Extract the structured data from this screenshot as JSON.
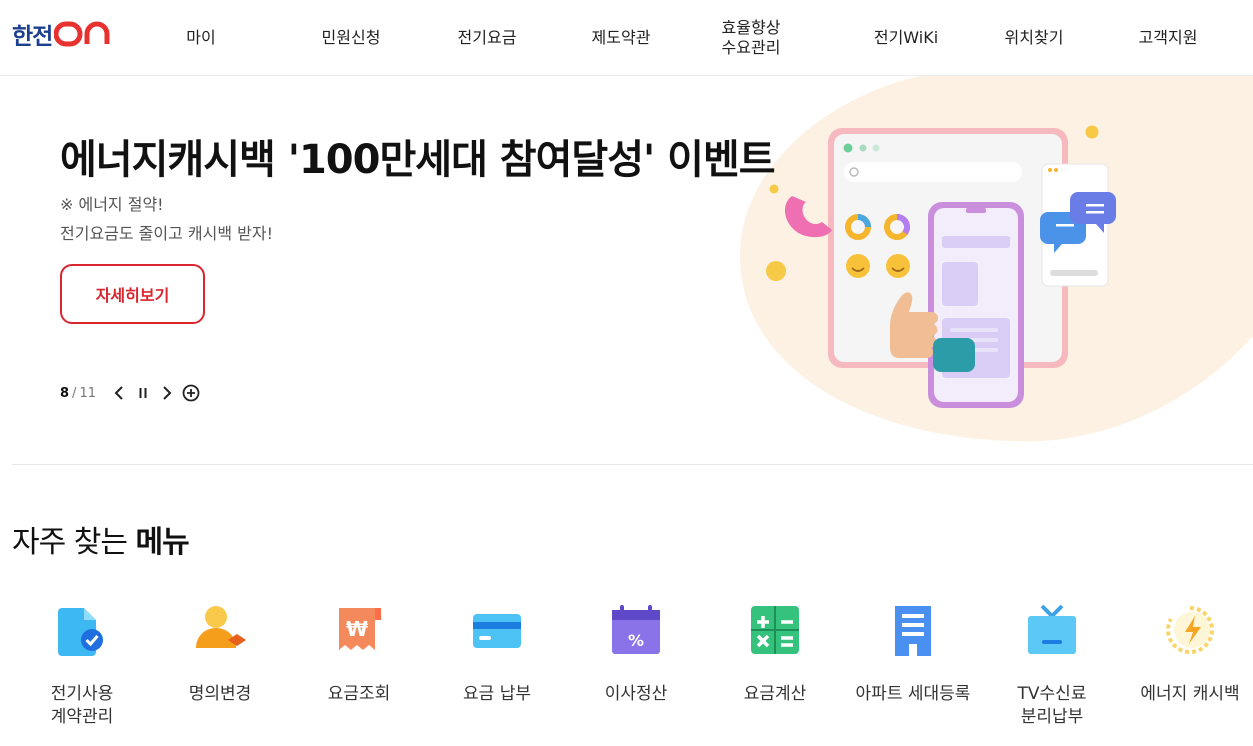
{
  "header": {
    "logo_text": "한전",
    "logo_suffix": "ON",
    "nav": [
      {
        "id": "my",
        "label": "마이"
      },
      {
        "id": "civil",
        "label": "민원신청"
      },
      {
        "id": "bill",
        "label": "전기요금"
      },
      {
        "id": "terms",
        "label": "제도약관"
      },
      {
        "id": "efficiency",
        "label": "효율향상\n수요관리"
      },
      {
        "id": "wiki",
        "label": "전기WiKi"
      },
      {
        "id": "location",
        "label": "위치찾기"
      },
      {
        "id": "support",
        "label": "고객지원"
      }
    ]
  },
  "hero": {
    "title": "에너지캐시백 '100만세대 참여달성' 이벤트",
    "sub1": "※ 에너지 절약!",
    "sub2": "전기요금도 줄이고 캐시백 받자!",
    "button": "자세히보기",
    "pager": {
      "current": "8",
      "separator": "/",
      "total": "11"
    }
  },
  "frequent": {
    "title_normal": "자주 찾는",
    "title_bold": "메뉴",
    "items": [
      {
        "label": "전기사용\n계약관리",
        "icon": "document-check-icon"
      },
      {
        "label": "명의변경",
        "icon": "user-change-icon"
      },
      {
        "label": "요금조회",
        "icon": "won-receipt-icon"
      },
      {
        "label": "요금 납부",
        "icon": "credit-card-icon"
      },
      {
        "label": "이사정산",
        "icon": "calendar-percent-icon"
      },
      {
        "label": "요금계산",
        "icon": "calculator-icon"
      },
      {
        "label": "아파트 세대등록",
        "icon": "apartment-icon"
      },
      {
        "label": "TV수신료\n분리납부",
        "icon": "tv-icon"
      },
      {
        "label": "에너지 캐시백",
        "icon": "energy-bolt-icon"
      }
    ]
  },
  "colors": {
    "brand_red": "#d9262e",
    "brand_blue": "#1d3f8f"
  }
}
